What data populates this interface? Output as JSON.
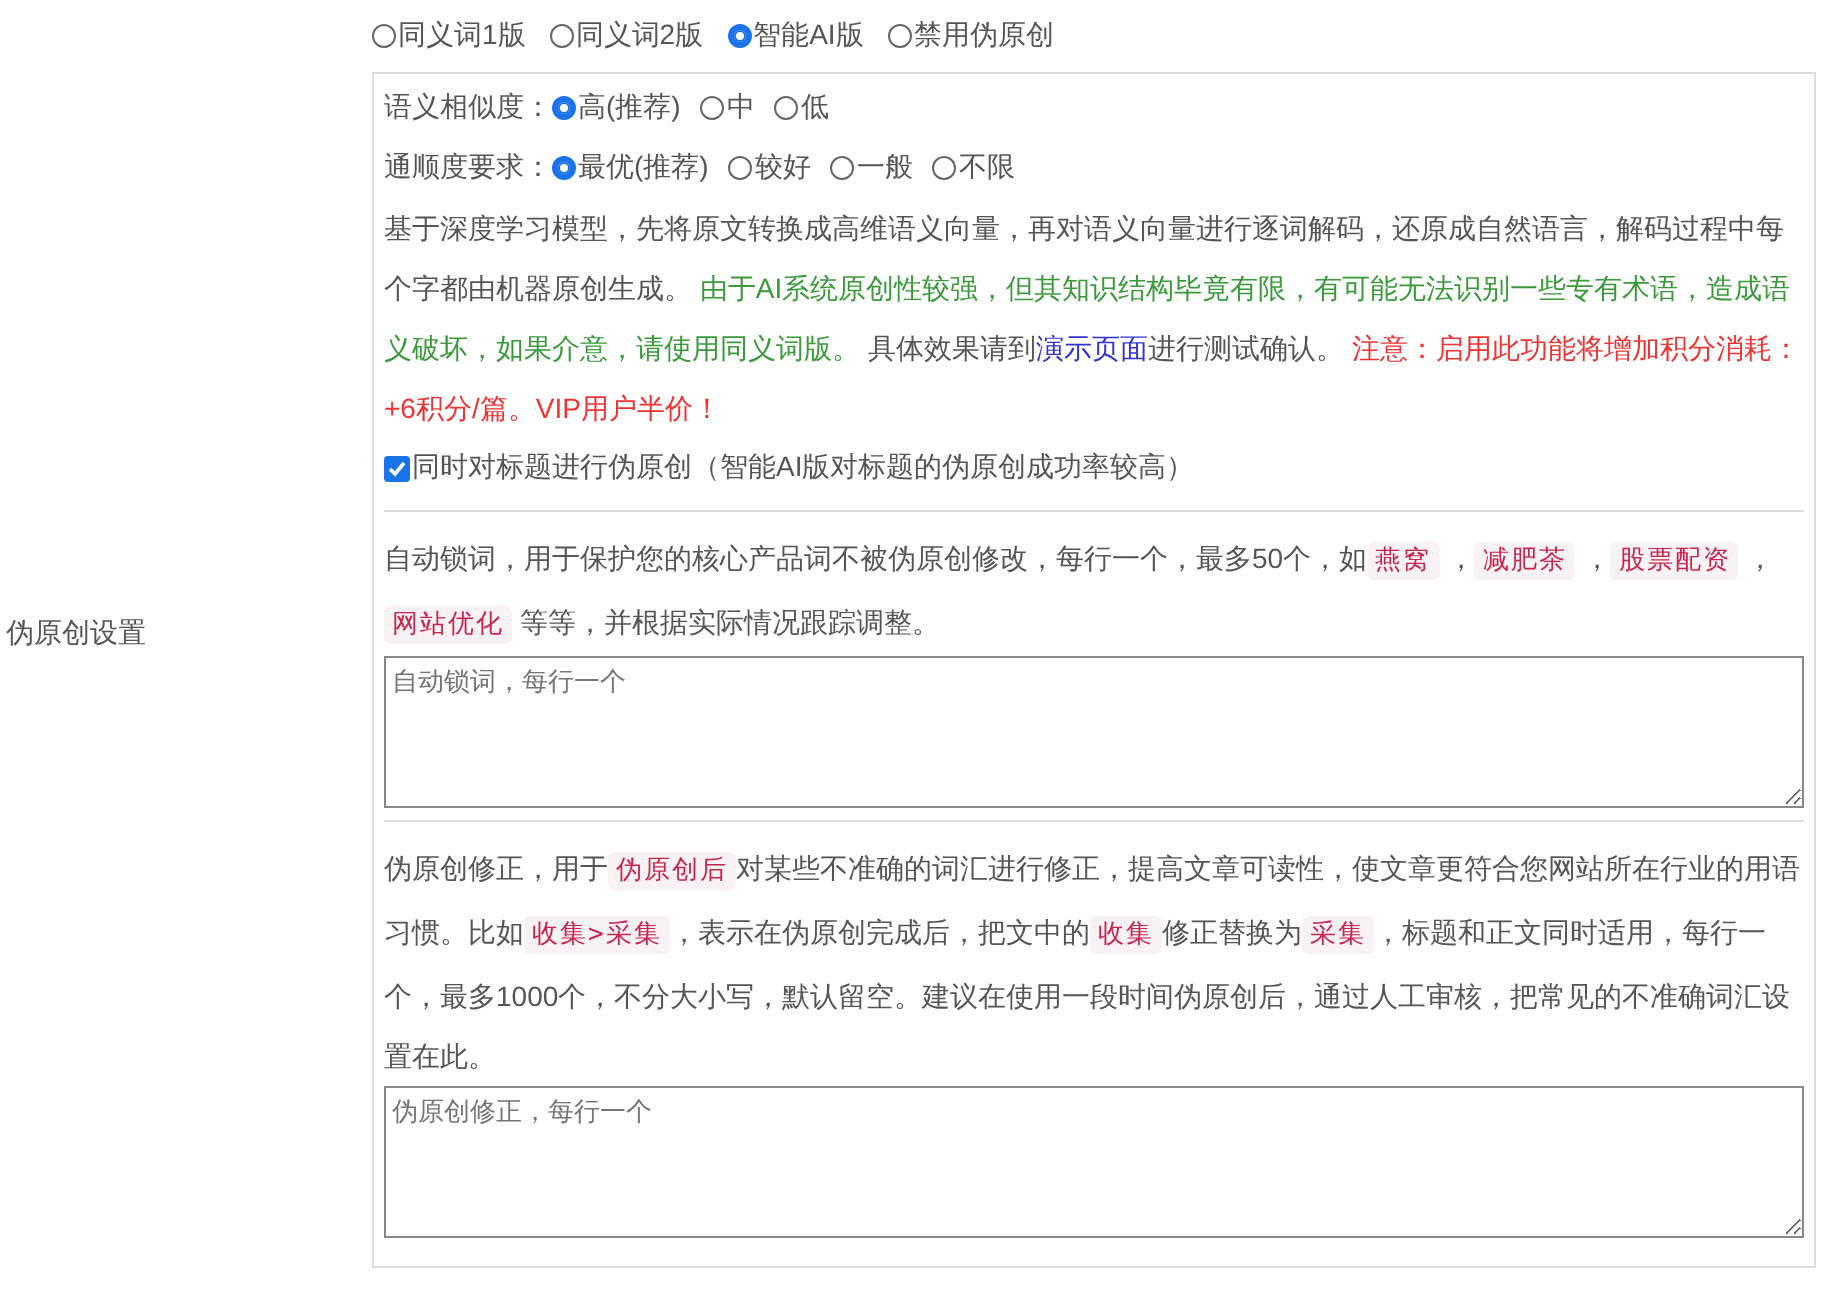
{
  "section_label": "伪原创设置",
  "versions": [
    {
      "label": "同义词1版",
      "selected": false
    },
    {
      "label": "同义词2版",
      "selected": false
    },
    {
      "label": "智能AI版",
      "selected": true
    },
    {
      "label": "禁用伪原创",
      "selected": false
    }
  ],
  "similarity": {
    "label": "语义相似度：",
    "options": [
      {
        "label": "高(推荐)",
        "selected": true
      },
      {
        "label": "中",
        "selected": false
      },
      {
        "label": "低",
        "selected": false
      }
    ]
  },
  "fluency": {
    "label": "通顺度要求：",
    "options": [
      {
        "label": "最优(推荐)",
        "selected": true
      },
      {
        "label": "较好",
        "selected": false
      },
      {
        "label": "一般",
        "selected": false
      },
      {
        "label": "不限",
        "selected": false
      }
    ]
  },
  "description": [
    {
      "kind": "plain",
      "text": "基于深度学习模型，先将原文转换成高维语义向量，再对语义向量进行逐词解码，还原成自然语言，解码过程中每个字都由机器原创生成。 "
    },
    {
      "kind": "note",
      "text": "由于AI系统原创性较强，但其知识结构毕竟有限，有可能无法识别一些专有术语，造成语义破坏，如果介意，请使用同义词版。"
    },
    {
      "kind": "plain",
      "text": " 具体效果请到"
    },
    {
      "kind": "link",
      "text": "演示页面"
    },
    {
      "kind": "plain",
      "text": "进行测试确认。 "
    },
    {
      "kind": "warning",
      "text": "注意：启用此功能将增加积分消耗：+6积分/篇。VIP用户半价！"
    }
  ],
  "title_option": {
    "label": "同时对标题进行伪原创（智能AI版对标题的伪原创成功率较高）",
    "checked": true
  },
  "lock_words": {
    "text": [
      {
        "kind": "plain",
        "text": "自动锁词，用于保护您的核心产品词不被伪原创修改，每行一个，最多50个，如"
      },
      {
        "kind": "tag",
        "text": "燕窝"
      },
      {
        "kind": "plain",
        "text": " ，"
      },
      {
        "kind": "tag",
        "text": "减肥茶"
      },
      {
        "kind": "plain",
        "text": " ，"
      },
      {
        "kind": "tag",
        "text": "股票配资"
      },
      {
        "kind": "plain",
        "text": " ，"
      },
      {
        "kind": "tag",
        "text": "网站优化"
      },
      {
        "kind": "plain",
        "text": " 等等，并根据实际情况跟踪调整。"
      }
    ],
    "placeholder": "自动锁词，每行一个"
  },
  "correction": {
    "text": [
      {
        "kind": "plain",
        "text": "伪原创修正，用于"
      },
      {
        "kind": "tag",
        "text": "伪原创后"
      },
      {
        "kind": "plain",
        "text": "对某些不准确的词汇进行修正，提高文章可读性，使文章更符合您网站所在行业的用语习惯。比如"
      },
      {
        "kind": "tag",
        "text": "收集>采集"
      },
      {
        "kind": "plain",
        "text": "，表示在伪原创完成后，把文中的"
      },
      {
        "kind": "tag",
        "text": "收集"
      },
      {
        "kind": "plain",
        "text": "修正替换为"
      },
      {
        "kind": "tag",
        "text": "采集"
      },
      {
        "kind": "plain",
        "text": "，标题和正文同时适用，每行一个，最多1000个，不分大小写，默认留空。建议在使用一段时间伪原创后，通过人工审核，把常见的不准确词汇设置在此。"
      }
    ],
    "placeholder": "伪原创修正，每行一个"
  }
}
